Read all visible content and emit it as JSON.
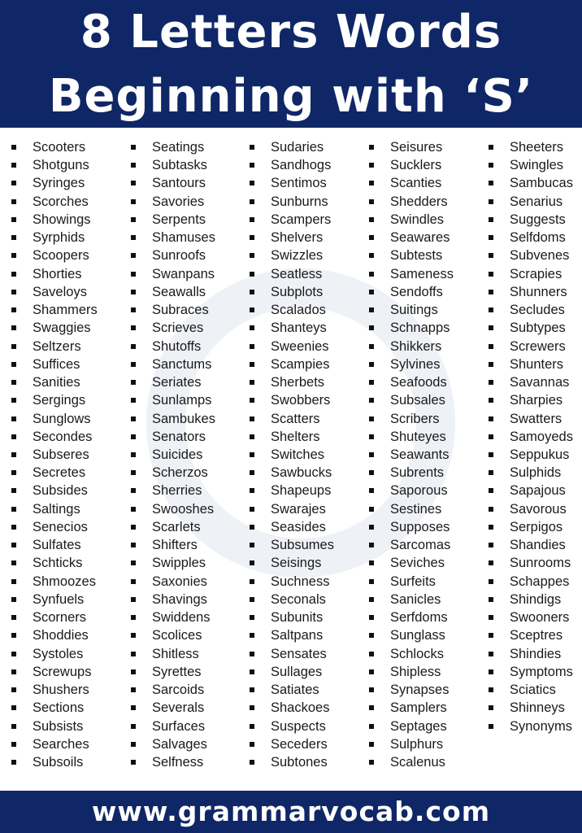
{
  "header": {
    "title_line1": "8 Letters Words",
    "title_line2": "Beginning with ‘S’"
  },
  "watermark": "GRAMMARVOCAB",
  "columns": [
    [
      "Scooters",
      "Shotguns",
      "Syringes",
      "Scorches",
      "Showings",
      "Syrphids",
      "Scoopers",
      "Shorties",
      "Saveloys",
      "Shammers",
      "Swaggies",
      "Seltzers",
      "Suffices",
      "Sanities",
      "Sergings",
      "Sunglows",
      "Secondes",
      "Subseres",
      "Secretes",
      "Subsides",
      "Saltings",
      "Senecios",
      "Sulfates",
      "Schticks",
      "Shmoozes",
      "Synfuels",
      "Scorners",
      "Shoddies",
      "Systoles",
      "Screwups",
      "Shushers",
      "Sections",
      "Subsists",
      "Searches",
      "Subsoils"
    ],
    [
      "Seatings",
      "Subtasks",
      "Santours",
      "Savories",
      "Serpents",
      "Shamuses",
      "Sunroofs",
      "Swanpans",
      "Seawalls",
      "Subraces",
      "Scrieves",
      "Shutoffs",
      "Sanctums",
      "Seriates",
      "Sunlamps",
      "Sambukes",
      "Senators",
      "Suicides",
      "Scherzos",
      "Sherries",
      "Swooshes",
      "Scarlets",
      "Shifters",
      "Swipples",
      "Saxonies",
      "Shavings",
      "Swiddens",
      "Scolices",
      "Shitless",
      "Syrettes",
      "Sarcoids",
      "Severals",
      "Surfaces",
      "Salvages",
      "Selfness"
    ],
    [
      "Sudaries",
      "Sandhogs",
      "Sentimos",
      "Sunburns",
      "Scampers",
      "Shelvers",
      "Swizzles",
      "Seatless",
      "Subplots",
      "Scalados",
      "Shanteys",
      "Sweenies",
      "Scampies",
      "Sherbets",
      "Swobbers",
      "Scatters",
      "Shelters",
      "Switches",
      "Sawbucks",
      "Shapeups",
      "Swarajes",
      "Seasides",
      "Subsumes",
      "Seisings",
      "Suchness",
      "Seconals",
      "Subunits",
      "Saltpans",
      "Sensates",
      "Sullages",
      "Satiates",
      "Shackoes",
      "Suspects",
      "Seceders",
      "Subtones"
    ],
    [
      "Seisures",
      "Sucklers",
      "Scanties",
      "Shedders",
      "Swindles",
      "Seawares",
      "Subtests",
      "Sameness",
      "Sendoffs",
      "Suitings",
      "Schnapps",
      "Shikkers",
      "Sylvines",
      "Seafoods",
      "Subsales",
      "Scribers",
      "Shuteyes",
      "Seawants",
      "Subrents",
      "Saporous",
      "Sestines",
      "Supposes",
      "Sarcomas",
      "Seviches",
      "Surfeits",
      "Sanicles",
      "Serfdoms",
      "Sunglass",
      "Schlocks",
      "Shipless",
      "Synapses",
      "Samplers",
      "Septages",
      "Sulphurs",
      "Scalenus"
    ],
    [
      "Sheeters",
      "Swingles",
      "Sambucas",
      "Senarius",
      "Suggests",
      "Selfdoms",
      "Subvenes",
      "Scrapies",
      "Shunners",
      "Secludes",
      "Subtypes",
      "Screwers",
      "Shunters",
      "Savannas",
      "Sharpies",
      "Swatters",
      "Samoyeds",
      "Seppukus",
      "Sulphids",
      "Sapajous",
      "Savorous",
      "Serpigos",
      "Shandies",
      "Sunrooms",
      "Schappes",
      "Shindigs",
      "Swooners",
      "Sceptres",
      "Shindies",
      "Symptoms",
      "Sciatics",
      "Shinneys",
      "Synonyms"
    ]
  ],
  "footer": {
    "url": "www.grammarvocab.com"
  },
  "colors": {
    "navy": "#0f2766",
    "text": "#1a1a1a"
  }
}
